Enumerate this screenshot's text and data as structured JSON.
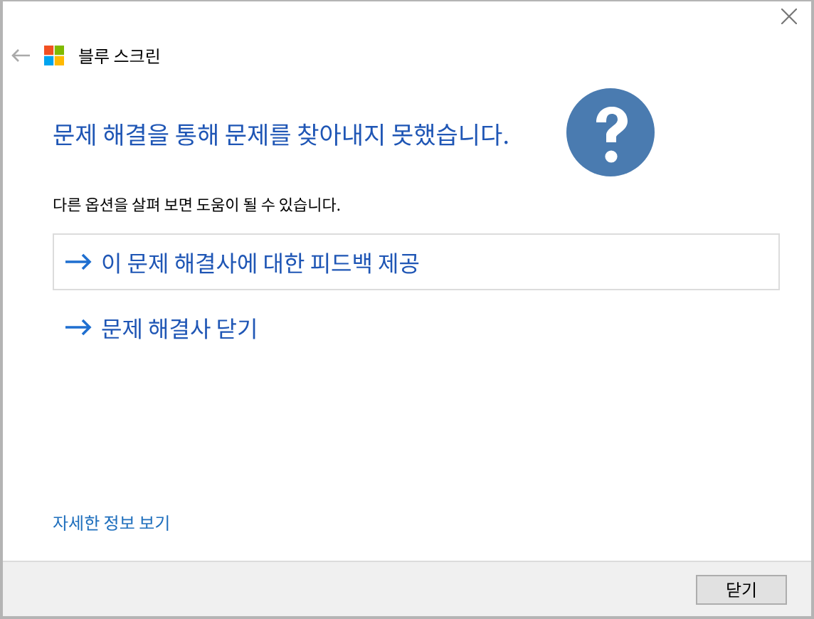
{
  "window": {
    "title": "블루 스크린"
  },
  "heading": "문제 해결을 통해 문제를 찾아내지 못했습니다.",
  "subtitle": "다른 옵션을 살펴 보면 도움이 될 수 있습니다.",
  "options": [
    {
      "label": "이 문제 해결사에 대한 피드백 제공",
      "focused": true
    },
    {
      "label": "문제 해결사 닫기",
      "focused": false
    }
  ],
  "details_link": "자세한 정보 보기",
  "buttons": [
    "닫기"
  ]
}
